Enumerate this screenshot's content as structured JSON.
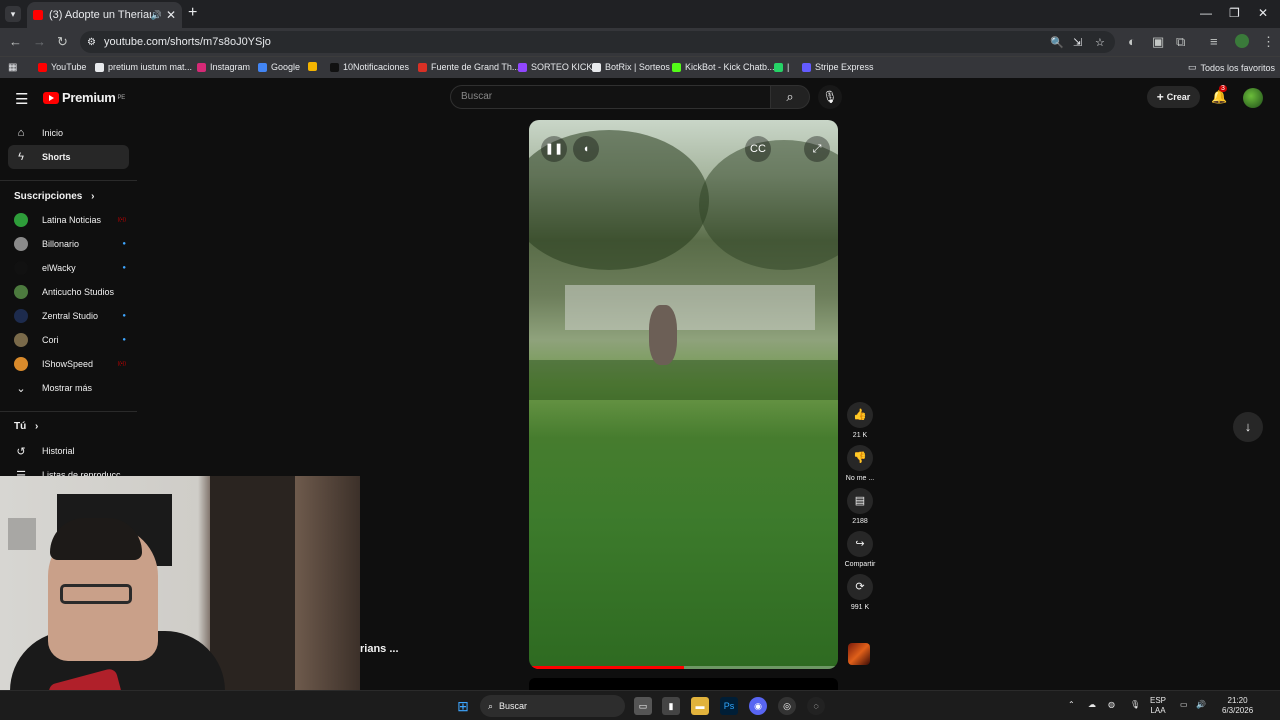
{
  "browser": {
    "tab_title": "(3) Adopte un Therian",
    "url": "youtube.com/shorts/m7s8oJ0YSjo",
    "bookmarks": [
      {
        "label": "YouTube",
        "color": "#ff0000"
      },
      {
        "label": "pretium iustum mat...",
        "color": "#e8eaed"
      },
      {
        "label": "Instagram",
        "color": "#d62976"
      },
      {
        "label": "Google",
        "color": "#4285f4"
      },
      {
        "label": "",
        "color": "#f4b400"
      },
      {
        "label": "10Notificaciones",
        "color": "#111111"
      },
      {
        "label": "Fuente de Grand Th...",
        "color": "#d93025"
      },
      {
        "label": "SORTEO KICK",
        "color": "#9146ff"
      },
      {
        "label": "BotRix | Sorteos",
        "color": "#e8eaed"
      },
      {
        "label": "KickBot - Kick Chatb...",
        "color": "#53fc18"
      },
      {
        "label": "|",
        "color": "#25d366"
      },
      {
        "label": "Stripe Express",
        "color": "#635bff"
      }
    ],
    "all_favorites": "Todos los favoritos"
  },
  "youtube": {
    "logo_text": "Premium",
    "logo_region": "PE",
    "search_placeholder": "Buscar",
    "create_label": "Crear",
    "notification_count": "3",
    "sidebar": {
      "home": "Inicio",
      "shorts": "Shorts",
      "subscriptions_header": "Suscripciones",
      "subscriptions": [
        {
          "name": "Latina Noticias",
          "color": "#2e9d3a",
          "status": "live"
        },
        {
          "name": "Billonario",
          "color": "#8a8a8a",
          "status": "new"
        },
        {
          "name": "elWacky",
          "color": "#111111",
          "status": "new"
        },
        {
          "name": "Anticucho Studios",
          "color": "#4c7a3e",
          "status": ""
        },
        {
          "name": "Zentral Studio",
          "color": "#1d2b4d",
          "status": "new"
        },
        {
          "name": "Cori",
          "color": "#7a6a4a",
          "status": "new"
        },
        {
          "name": "IShowSpeed",
          "color": "#d98a2b",
          "status": "live"
        }
      ],
      "live_label": "((•))",
      "show_more": "Mostrar más",
      "you_header": "Tú",
      "history": "Historial",
      "playlists": "Listas de reproducc..."
    },
    "short": {
      "progress": 0.5,
      "likes": "21 K",
      "dislike_label": "No me ...",
      "comments": "2188",
      "share_label": "Compartir",
      "remix": "991 K",
      "overlay_title_fragment": "rians ..."
    }
  },
  "taskbar": {
    "search_label": "Buscar",
    "lang_top": "ESP",
    "lang_bottom": "LAA",
    "time": "21:20",
    "date": "6/3/2026"
  }
}
